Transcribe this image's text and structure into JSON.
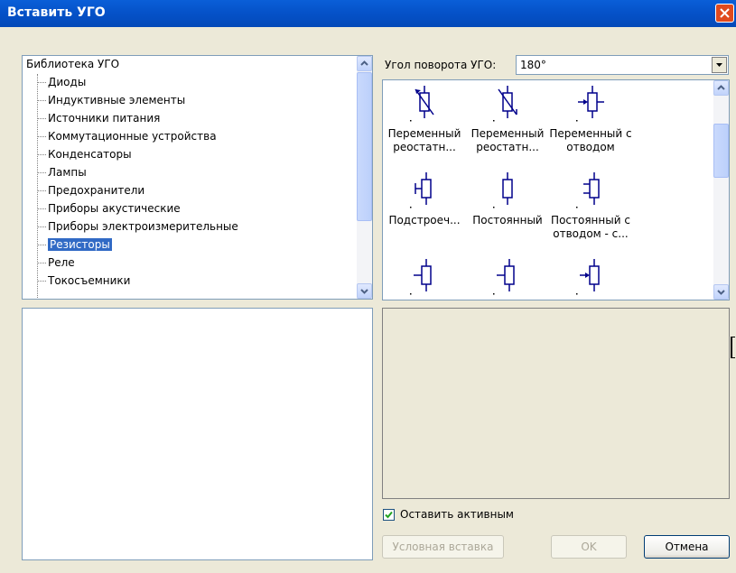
{
  "window": {
    "title": "Вставить УГО"
  },
  "tree": {
    "root": "Библиотека УГО",
    "items": [
      "Диоды",
      "Индуктивные элементы",
      "Источники питания",
      "Коммутационные устройства",
      "Конденсаторы",
      "Лампы",
      "Предохранители",
      "Приборы акустические",
      "Приборы электроизмерительные",
      "Резисторы",
      "Реле",
      "Токосъемники"
    ],
    "selected": "Резисторы"
  },
  "rotation": {
    "label": "Угол поворота УГО:",
    "value": "180°"
  },
  "gallery": {
    "items": [
      {
        "caption": [
          "Переменный",
          "реостатн..."
        ],
        "icon": "variable-rheostat-icon"
      },
      {
        "caption": [
          "Переменный",
          "реостатн..."
        ],
        "icon": "variable-rheostat-icon"
      },
      {
        "caption": [
          "Переменный с",
          "отводом"
        ],
        "icon": "variable-tap-resistor-icon"
      },
      {
        "caption": [
          "Подстроеч..."
        ],
        "icon": "trimmer-resistor-icon"
      },
      {
        "caption": [
          "Постоянный"
        ],
        "icon": "fixed-resistor-icon"
      },
      {
        "caption": [
          "Постоянный с",
          "отводом - с..."
        ],
        "icon": "tapped-resistor-icon"
      },
      {
        "caption": [
          ""
        ],
        "icon": "resistor-icon"
      },
      {
        "caption": [
          ""
        ],
        "icon": "resistor-icon"
      },
      {
        "caption": [
          ""
        ],
        "icon": "resistor-icon"
      }
    ]
  },
  "options": {
    "keep_active_label": "Оставить активным",
    "keep_active_checked": true
  },
  "buttons": {
    "conditional_insert": "Условная вставка",
    "ok": "OK",
    "cancel": "Отмена"
  }
}
